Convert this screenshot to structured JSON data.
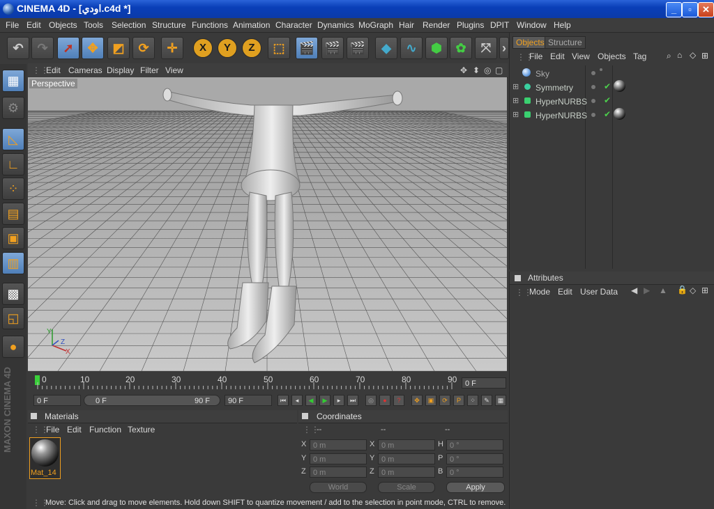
{
  "window": {
    "title": "CINEMA 4D - [اودي.c4d *]"
  },
  "menubar": [
    "File",
    "Edit",
    "Objects",
    "Tools",
    "Selection",
    "Structure",
    "Functions",
    "Animation",
    "Character",
    "Dynamics",
    "MoGraph",
    "Hair",
    "Render",
    "Plugins",
    "DPIT",
    "Window",
    "Help"
  ],
  "toolbar": {
    "x": "X",
    "y": "Y",
    "z": "Z"
  },
  "viewport": {
    "menu": [
      "Edit",
      "Cameras",
      "Display",
      "Filter",
      "View"
    ],
    "label": "Perspective",
    "axis_x": "X",
    "axis_y": "Y",
    "axis_z": "Z"
  },
  "timeline": {
    "ticks": [
      "0",
      "10",
      "20",
      "30",
      "40",
      "50",
      "60",
      "70",
      "80",
      "90"
    ],
    "current_frame": "0 F",
    "start_field": "0 F",
    "range_start": "0 F",
    "range_end": "90 F",
    "end_field": "90 F"
  },
  "materials": {
    "header": "Materials",
    "menu": [
      "File",
      "Edit",
      "Function",
      "Texture"
    ],
    "items": [
      {
        "name": "Mat_14"
      }
    ]
  },
  "coordinates": {
    "header": "Coordinates",
    "col_headers": [
      "--",
      "--",
      "--"
    ],
    "rows": [
      {
        "l1": "X",
        "v1": "0 m",
        "l2": "X",
        "v2": "0 m",
        "l3": "H",
        "v3": "0 °"
      },
      {
        "l1": "Y",
        "v1": "0 m",
        "l2": "Y",
        "v2": "0 m",
        "l3": "P",
        "v3": "0 °"
      },
      {
        "l1": "Z",
        "v1": "0 m",
        "l2": "Z",
        "v2": "0 m",
        "l3": "B",
        "v3": "0 °"
      }
    ],
    "world": "World",
    "scale": "Scale",
    "apply": "Apply"
  },
  "objects": {
    "tabs": [
      "Objects",
      "Structure"
    ],
    "menu": [
      "File",
      "Edit",
      "View",
      "Objects",
      "Tag"
    ],
    "items": [
      {
        "name": "Sky"
      },
      {
        "name": "Symmetry"
      },
      {
        "name": "HyperNURBS"
      },
      {
        "name": "HyperNURBS"
      }
    ]
  },
  "attributes": {
    "header": "Attributes",
    "menu": [
      "Mode",
      "Edit",
      "User Data"
    ]
  },
  "brand": "MAXON CINEMA 4D",
  "status": "Move: Click and drag to move elements. Hold down SHIFT to quantize movement / add to the selection in point mode, CTRL to remove."
}
